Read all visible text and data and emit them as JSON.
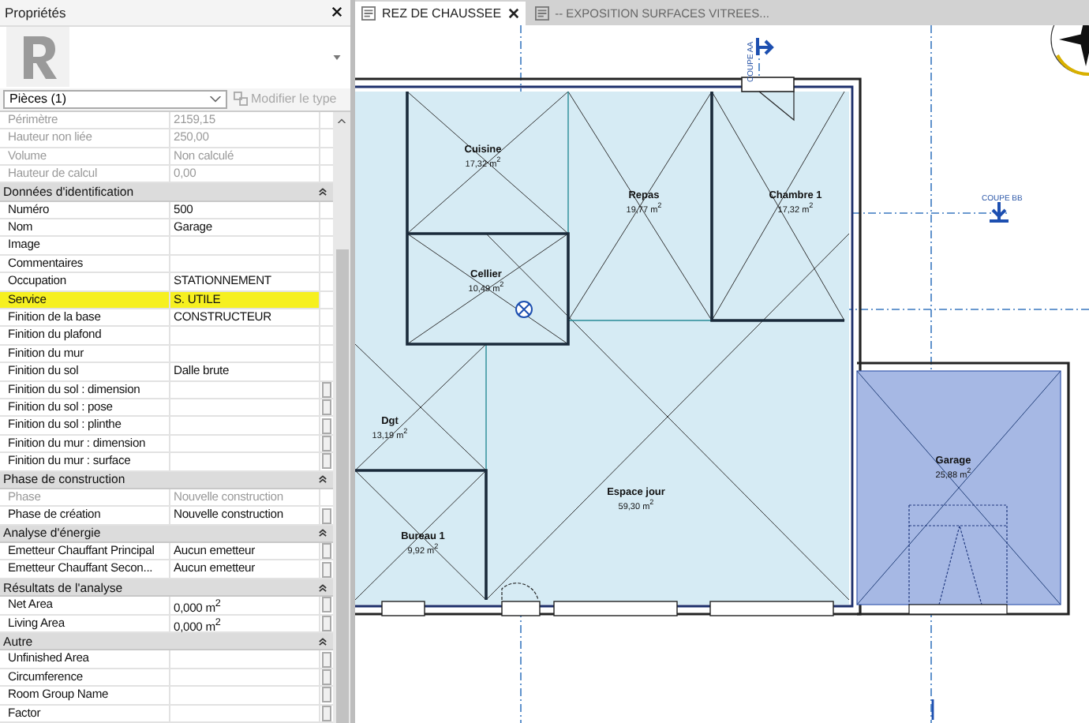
{
  "properties": {
    "title": "Propriétés",
    "type_selector": {
      "label": "Pièces (1)"
    },
    "edit_type_button": {
      "label": "Modifier le type",
      "disabled": true
    },
    "groups": [
      {
        "rows": [
          {
            "label": "Périmètre",
            "value": "2159,15",
            "disabled": true,
            "highlighted": false,
            "param_button": false
          },
          {
            "label": "Hauteur non liée",
            "value": "250,00",
            "disabled": true,
            "highlighted": false,
            "param_button": false
          },
          {
            "label": "Volume",
            "value": "Non calculé",
            "disabled": true,
            "highlighted": false,
            "param_button": false
          },
          {
            "label": "Hauteur de calcul",
            "value": "0,00",
            "disabled": true,
            "highlighted": false,
            "param_button": false
          }
        ]
      },
      {
        "heading": "Données d'identification",
        "rows": [
          {
            "label": "Numéro",
            "value": "500",
            "disabled": false,
            "highlighted": false,
            "param_button": false
          },
          {
            "label": "Nom",
            "value": "Garage",
            "disabled": false,
            "highlighted": false,
            "param_button": false
          },
          {
            "label": "Image",
            "value": "",
            "disabled": false,
            "highlighted": false,
            "param_button": false
          },
          {
            "label": "Commentaires",
            "value": "",
            "disabled": false,
            "highlighted": false,
            "param_button": false
          },
          {
            "label": "Occupation",
            "value": "STATIONNEMENT",
            "disabled": false,
            "highlighted": false,
            "param_button": false
          },
          {
            "label": "Service",
            "value": "S. UTILE",
            "disabled": false,
            "highlighted": true,
            "param_button": false
          },
          {
            "label": "Finition de la base",
            "value": "CONSTRUCTEUR",
            "disabled": false,
            "highlighted": false,
            "param_button": false
          },
          {
            "label": "Finition du plafond",
            "value": "",
            "disabled": false,
            "highlighted": false,
            "param_button": false
          },
          {
            "label": "Finition du mur",
            "value": "",
            "disabled": false,
            "highlighted": false,
            "param_button": false
          },
          {
            "label": "Finition du sol",
            "value": "Dalle brute",
            "disabled": false,
            "highlighted": false,
            "param_button": false
          },
          {
            "label": "Finition du sol : dimension",
            "value": "",
            "disabled": false,
            "highlighted": false,
            "param_button": true
          },
          {
            "label": "Finition du sol : pose",
            "value": "",
            "disabled": false,
            "highlighted": false,
            "param_button": true
          },
          {
            "label": "Finition du sol : plinthe",
            "value": "",
            "disabled": false,
            "highlighted": false,
            "param_button": true
          },
          {
            "label": "Finition du mur : dimension",
            "value": "",
            "disabled": false,
            "highlighted": false,
            "param_button": true
          },
          {
            "label": "Finition du mur : surface",
            "value": "",
            "disabled": false,
            "highlighted": false,
            "param_button": true
          }
        ]
      },
      {
        "heading": "Phase de construction",
        "rows": [
          {
            "label": "Phase",
            "value": "Nouvelle construction",
            "disabled": true,
            "highlighted": false,
            "param_button": false
          },
          {
            "label": "Phase de création",
            "value": "Nouvelle construction",
            "disabled": false,
            "highlighted": false,
            "param_button": true
          }
        ]
      },
      {
        "heading": "Analyse d'énergie",
        "rows": [
          {
            "label": "Emetteur Chauffant Principal",
            "value": "Aucun emetteur",
            "disabled": false,
            "highlighted": false,
            "param_button": true
          },
          {
            "label": "Emetteur Chauffant Secon...",
            "value": "Aucun emetteur",
            "disabled": false,
            "highlighted": false,
            "param_button": true
          }
        ]
      },
      {
        "heading": "Résultats de l'analyse",
        "rows": [
          {
            "label": "Net Area",
            "value": "0,000 m$^{2}$",
            "disabled": false,
            "highlighted": false,
            "param_button": true
          },
          {
            "label": "Living Area",
            "value": "0,000 m$^{2}$",
            "disabled": false,
            "highlighted": false,
            "param_button": true
          }
        ]
      },
      {
        "heading": "Autre",
        "rows": [
          {
            "label": "Unfinished Area",
            "value": "",
            "disabled": false,
            "highlighted": false,
            "param_button": true
          },
          {
            "label": "Circumference",
            "value": "",
            "disabled": false,
            "highlighted": false,
            "param_button": true
          },
          {
            "label": "Room Group Name",
            "value": "",
            "disabled": false,
            "highlighted": false,
            "param_button": true
          },
          {
            "label": "Factor",
            "value": "",
            "disabled": false,
            "highlighted": false,
            "param_button": true
          }
        ]
      }
    ]
  },
  "tabs": [
    {
      "label": "REZ DE CHAUSSEE",
      "selected": true
    },
    {
      "label": "-- EXPOSITION SURFACES VITREES...",
      "selected": false
    }
  ],
  "plan": {
    "rooms": [
      {
        "name": "Cuisine",
        "area": "17,32 m$^{2}$"
      },
      {
        "name": "Repas",
        "area": "19,77 m$^{2}$"
      },
      {
        "name": "Chambre 1",
        "area": "17,32 m$^{2}$"
      },
      {
        "name": "Cellier",
        "area": "10,49 m$^{2}$"
      },
      {
        "name": "Dgt",
        "area": "13,19 m$^{2}$"
      },
      {
        "name": "Espace jour",
        "area": "59,30 m$^{2}$"
      },
      {
        "name": "Bureau 1",
        "area": "9,92 m$^{2}$"
      },
      {
        "name": "Garage",
        "area": "25,88 m$^{2}$"
      }
    ],
    "sections": [
      {
        "label": "COUPE AA"
      },
      {
        "label": "COUPE BB"
      }
    ]
  }
}
